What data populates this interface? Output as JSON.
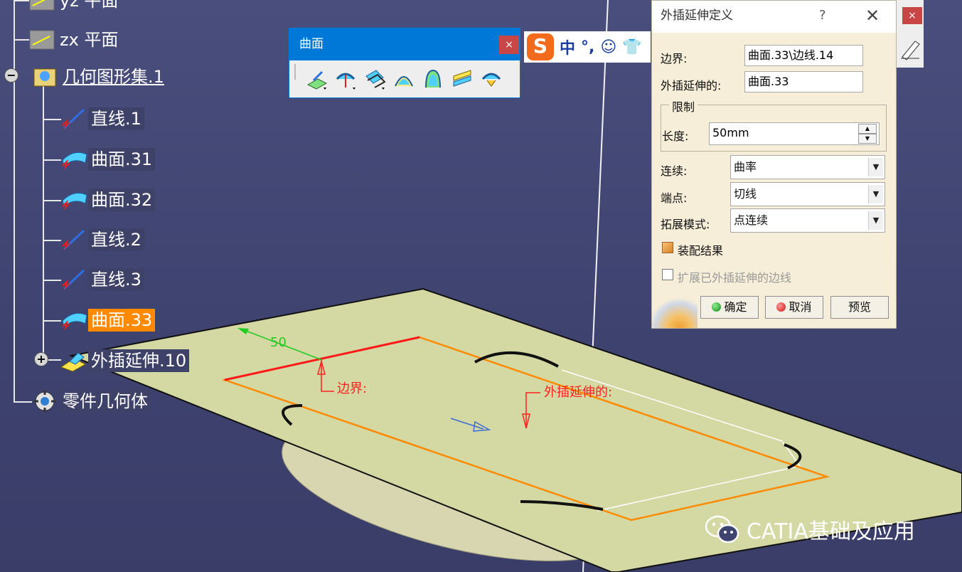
{
  "spec_tree": {
    "nodes": [
      {
        "label": "yz 平面",
        "icon": "plane-icon"
      },
      {
        "label": "zx 平面",
        "icon": "plane-icon"
      },
      {
        "label": "几何图形集.1",
        "icon": "geometrical-set-icon"
      },
      {
        "label": "直线.1",
        "icon": "line-icon"
      },
      {
        "label": "曲面.31",
        "icon": "surface-icon"
      },
      {
        "label": "曲面.32",
        "icon": "surface-icon"
      },
      {
        "label": "直线.2",
        "icon": "line-icon"
      },
      {
        "label": "直线.3",
        "icon": "line-icon"
      },
      {
        "label": "曲面.33",
        "icon": "surface-icon"
      },
      {
        "label": "外插延伸.10",
        "icon": "extrapolate-icon"
      },
      {
        "label": "零件几何体",
        "icon": "part-body-icon"
      }
    ],
    "selected": "曲面.33"
  },
  "surface_toolbar": {
    "title": "曲面",
    "close": "×",
    "icons": [
      "extrude-icon",
      "revolve-icon",
      "offset-icon",
      "sweep-icon",
      "fill-icon",
      "multi-section-icon",
      "blend-icon"
    ]
  },
  "ime_bar": {
    "logo": "S",
    "items": [
      "中",
      "°,",
      "☺",
      "👕"
    ]
  },
  "dialog": {
    "title": "外插延伸定义",
    "help": "?",
    "close": "✕",
    "boundary_label": "边界:",
    "boundary_value": "曲面.33\\边线.14",
    "extrapolated_label": "外插延伸的:",
    "extrapolated_value": "曲面.33",
    "limit_group": "限制",
    "length_label": "长度:",
    "length_value": "50mm",
    "continuity_label": "连续:",
    "continuity_value": "曲率",
    "endpoints_label": "端点:",
    "endpoints_value": "切线",
    "propagation_label": "拓展模式:",
    "propagation_value": "点连续",
    "assemble_label": "装配结果",
    "assemble_checked": true,
    "extend_label": "扩展已外插延伸的边线",
    "extend_checked": false,
    "ok_label": "确定",
    "cancel_label": "取消",
    "preview_label": "预览"
  },
  "viewport": {
    "dimension_value": "50",
    "boundary_annotation": "边界:",
    "extrapolated_annotation": "外插延伸的:"
  },
  "watermark": {
    "text": "CATIA基础及应用"
  },
  "colors": {
    "background": "#41456f",
    "plane_fill": "#d4d8a2",
    "selection_orange": "#ff8a00",
    "annotation_red": "#ff2020",
    "dimension_green": "#22cc22",
    "toolbar_blue": "#0078d7",
    "dialog_bg": "#f6eed8"
  }
}
